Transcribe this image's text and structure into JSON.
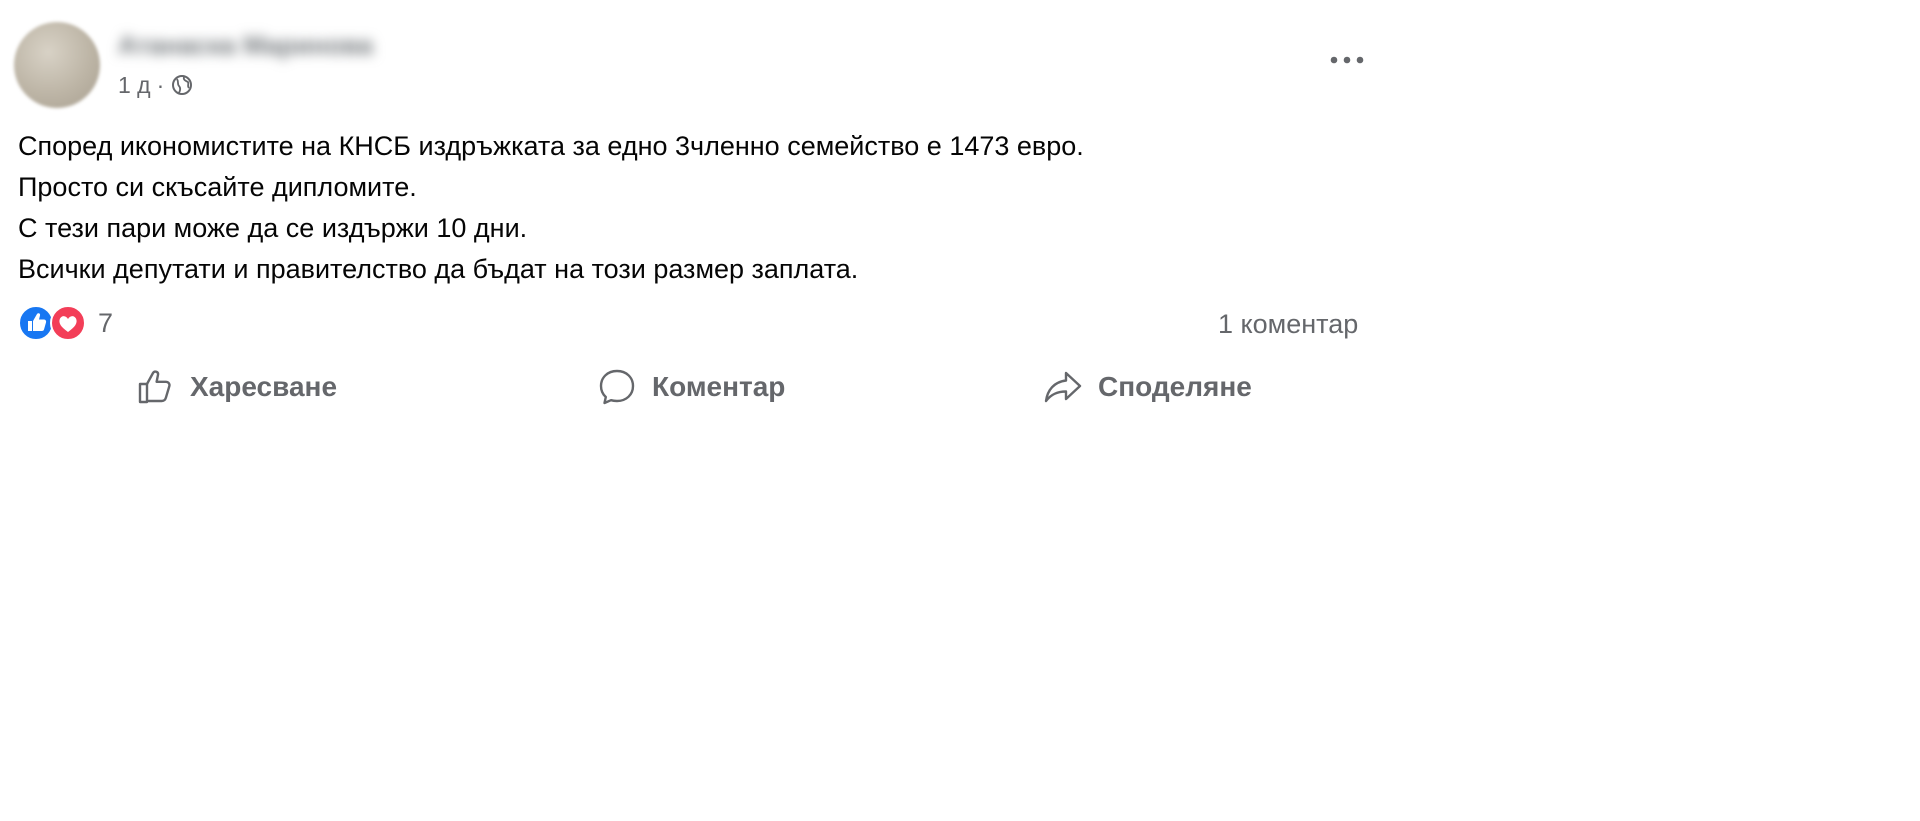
{
  "post": {
    "author_name": "Атанаска Маринова",
    "time": "1 д",
    "meta_separator": "·",
    "privacy_icon": "globe-icon",
    "more_icon": "more-options-icon"
  },
  "content": {
    "lines": [
      "Според икономистите на КНСБ издръжката за едно 3членно семейство е 1473 евро.",
      "Просто си скъсайте дипломите.",
      "С тези пари може да се издържи 10 дни.",
      "Всички депутати и правителство да бъдат на този размер заплата."
    ]
  },
  "reactions": {
    "icons": [
      "like-reaction-icon",
      "love-reaction-icon"
    ],
    "count": "7",
    "comments": "1 коментар"
  },
  "actions": {
    "like": "Харесване",
    "comment": "Коментар",
    "share": "Споделяне"
  },
  "colors": {
    "like_blue": "#1877f2",
    "love_red": "#f33e58",
    "secondary_text": "#65676b"
  }
}
